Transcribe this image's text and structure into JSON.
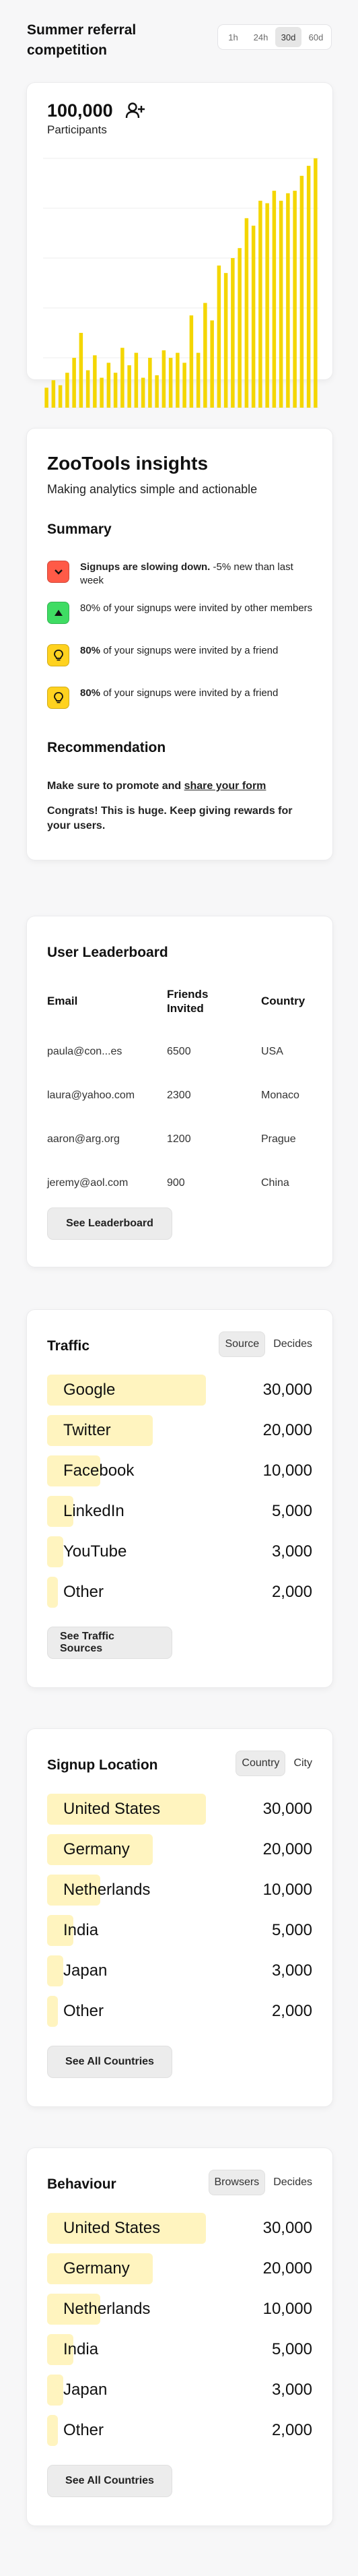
{
  "header": {
    "title": "Summer referral competition",
    "ranges": [
      "1h",
      "24h",
      "30d",
      "60d"
    ],
    "active_range": "30d"
  },
  "participants": {
    "count": "100,000",
    "label": "Participants",
    "chart_data": {
      "type": "bar",
      "ylim": [
        0,
        100
      ],
      "values": [
        8,
        11,
        9,
        14,
        20,
        30,
        15,
        21,
        12,
        18,
        14,
        24,
        17,
        22,
        12,
        20,
        13,
        23,
        20,
        22,
        18,
        37,
        22,
        42,
        35,
        57,
        54,
        60,
        64,
        76,
        73,
        83,
        82,
        87,
        83,
        86,
        87,
        93,
        97,
        100
      ]
    }
  },
  "insights": {
    "title": "ZooTools insights",
    "subtitle": "Making analytics simple and actionable",
    "summary_heading": "Summary",
    "items": [
      {
        "bold": "Signups are slowing down.",
        "rest": " -5% new than last week",
        "icon": "chevron-down-icon",
        "color": "#ff5a47"
      },
      {
        "bold": "",
        "rest": "80% of your signups were invited by other members",
        "icon": "triangle-up-icon",
        "color": "#3fdc63"
      },
      {
        "bold": "80%",
        "rest": " of your signups were invited by a friend",
        "icon": "lightbulb-icon",
        "color": "#ffd21f"
      },
      {
        "bold": "80%",
        "rest": " of your signups were invited by a friend",
        "icon": "lightbulb-icon",
        "color": "#ffd21f"
      }
    ],
    "recommendation_heading": "Recommendation",
    "recommendation_pre": "Make sure to promote and ",
    "recommendation_link": "share your form",
    "congrats": "Congrats! This is huge. Keep giving rewards for your users."
  },
  "leaderboard": {
    "title": "User Leaderboard",
    "columns": [
      "Email",
      "Friends Invited",
      "Country"
    ],
    "rows": [
      [
        "paula@con...es",
        "6500",
        "USA"
      ],
      [
        "laura@yahoo.com",
        "2300",
        "Monaco"
      ],
      [
        "aaron@arg.org",
        "1200",
        "Prague"
      ],
      [
        "jeremy@aol.com",
        "900",
        "China"
      ]
    ],
    "button": "See Leaderboard"
  },
  "traffic": {
    "title": "Traffic",
    "tabs": [
      "Source",
      "Decides"
    ],
    "active_tab": "Source",
    "rows": [
      {
        "label": "Google",
        "value": "30,000",
        "share": 1.0
      },
      {
        "label": "Twitter",
        "value": "20,000",
        "share": 0.667
      },
      {
        "label": "Facebook",
        "value": "10,000",
        "share": 0.333
      },
      {
        "label": "LinkedIn",
        "value": "5,000",
        "share": 0.167
      },
      {
        "label": "YouTube",
        "value": "3,000",
        "share": 0.1
      },
      {
        "label": "Other",
        "value": "2,000",
        "share": 0.067
      }
    ],
    "button": "See Traffic Sources"
  },
  "location": {
    "title": "Signup Location",
    "tabs": [
      "Country",
      "City"
    ],
    "active_tab": "Country",
    "rows": [
      {
        "label": "United States",
        "value": "30,000",
        "share": 1.0
      },
      {
        "label": "Germany",
        "value": "20,000",
        "share": 0.667
      },
      {
        "label": "Netherlands",
        "value": "10,000",
        "share": 0.333
      },
      {
        "label": "India",
        "value": "5,000",
        "share": 0.167
      },
      {
        "label": "Japan",
        "value": "3,000",
        "share": 0.1
      },
      {
        "label": "Other",
        "value": "2,000",
        "share": 0.067
      }
    ],
    "button": "See All Countries"
  },
  "behaviour": {
    "title": "Behaviour",
    "tabs": [
      "Browsers",
      "Decides"
    ],
    "active_tab": "Browsers",
    "rows": [
      {
        "label": "United States",
        "value": "30,000",
        "share": 1.0
      },
      {
        "label": "Germany",
        "value": "20,000",
        "share": 0.667
      },
      {
        "label": "Netherlands",
        "value": "10,000",
        "share": 0.333
      },
      {
        "label": "India",
        "value": "5,000",
        "share": 0.167
      },
      {
        "label": "Japan",
        "value": "3,000",
        "share": 0.1
      },
      {
        "label": "Other",
        "value": "2,000",
        "share": 0.067
      }
    ],
    "button": "See All Countries"
  },
  "colors": {
    "accent_bar": "#f4d600",
    "bar_fill_bg": "#fff4bf",
    "gridline": "#ececec"
  }
}
